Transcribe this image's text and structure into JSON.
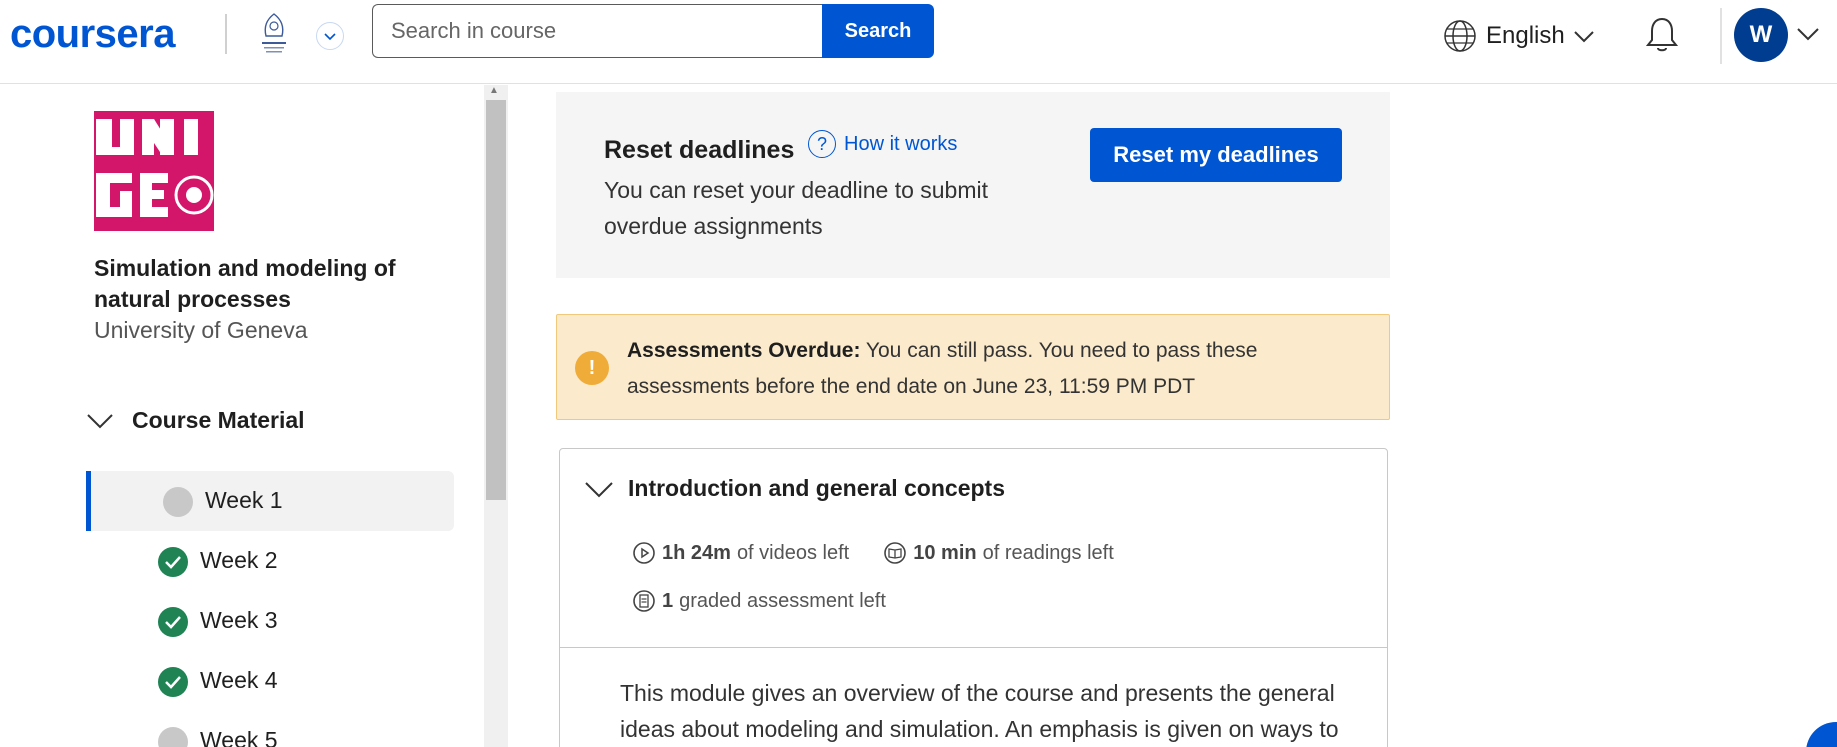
{
  "header": {
    "logo_text": "coursera",
    "search_placeholder": "Search in course",
    "search_button": "Search",
    "language": "English",
    "avatar_initial": "W"
  },
  "sidebar": {
    "course_title": "Simulation and modeling of natural processes",
    "university": "University of Geneva",
    "section_label": "Course Material",
    "weeks": [
      {
        "label": "Week 1",
        "status": "in-progress"
      },
      {
        "label": "Week 2",
        "status": "completed"
      },
      {
        "label": "Week 3",
        "status": "completed"
      },
      {
        "label": "Week 4",
        "status": "completed"
      },
      {
        "label": "Week 5",
        "status": "in-progress"
      }
    ]
  },
  "reset": {
    "title": "Reset deadlines",
    "how_it_works": "How it works",
    "description": "You can reset your deadline to submit overdue assignments",
    "button": "Reset my deadlines"
  },
  "overdue": {
    "heading": "Assessments Overdue:",
    "message": "You can still pass. You need to pass these assessments before the end date on June 23, 11:59 PM PDT"
  },
  "module": {
    "title": "Introduction and general concepts",
    "videos_amount": "1h 24m",
    "videos_label": "of videos left",
    "readings_amount": "10 min",
    "readings_label": "of readings left",
    "assessments_amount": "1",
    "assessments_label": "graded assessment left",
    "description": "This module gives an overview of the course and presents the general ideas about modeling and simulation. An emphasis is given on ways to"
  },
  "colors": {
    "brand": "#0056d2",
    "completed": "#1f8354",
    "warning_bg": "#fbeacb",
    "course_logo": "#d4166a"
  }
}
